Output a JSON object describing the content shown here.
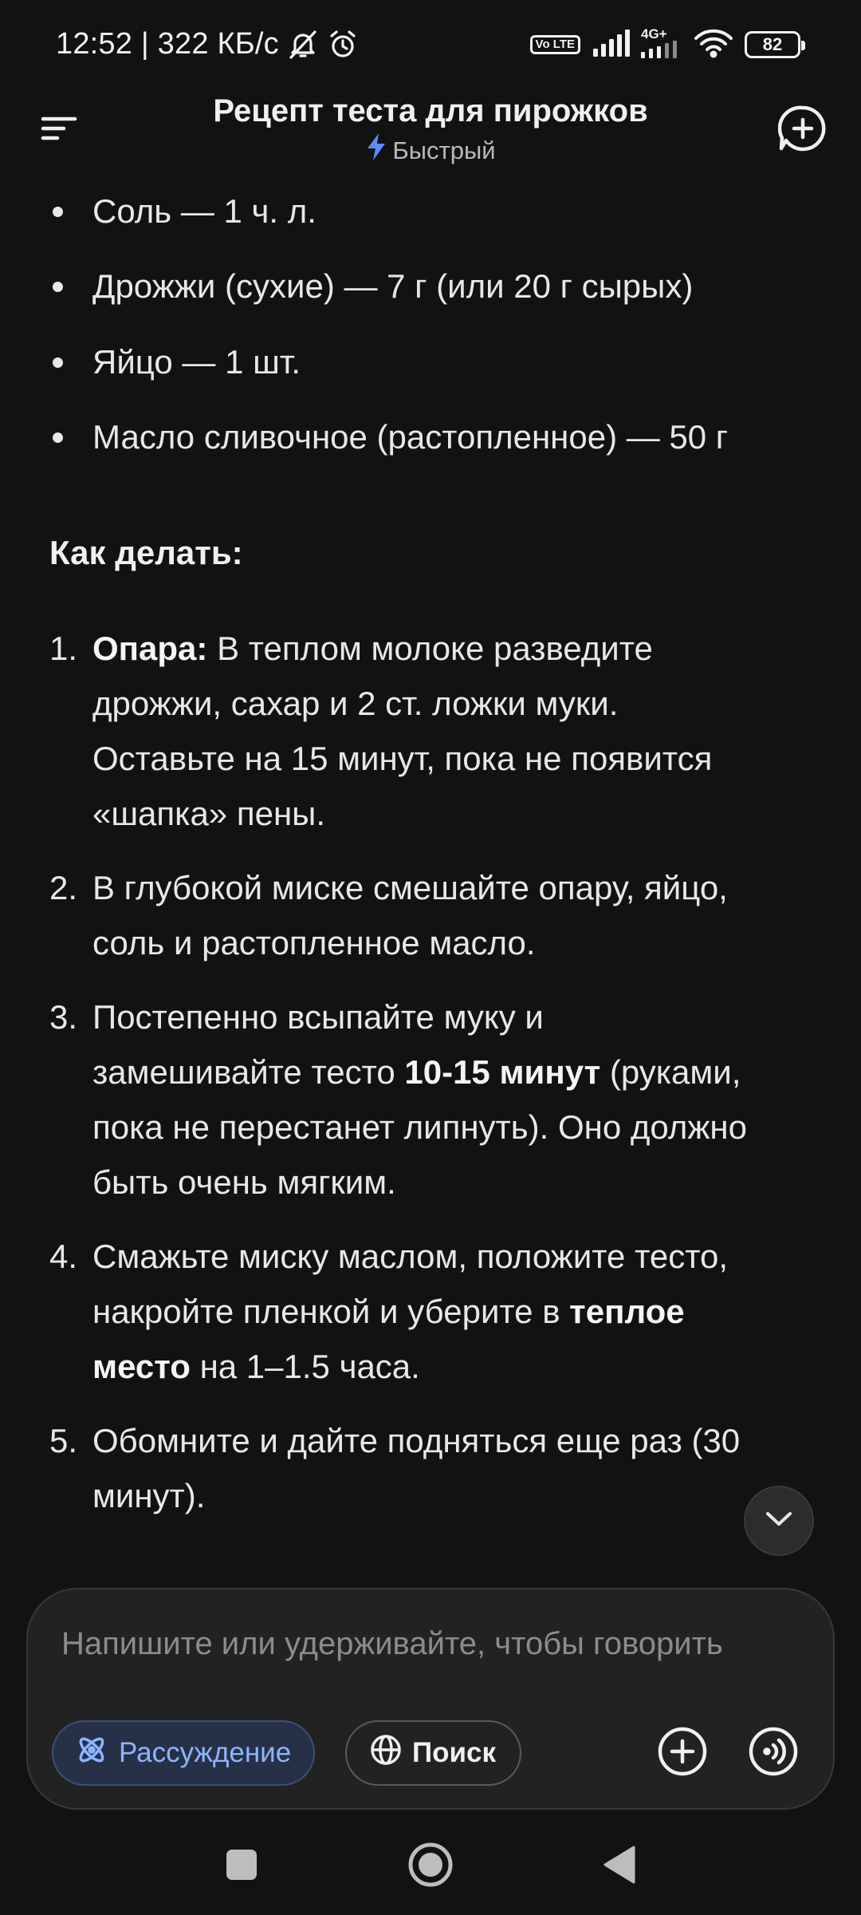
{
  "status_bar": {
    "time_speed": "12:52 | 322 КБ/с",
    "volte": "Vo LTE",
    "network_type": "4G+",
    "battery": "82"
  },
  "header": {
    "title": "Рецепт теста для пирожков",
    "mode": "Быстрый",
    "accent_color": "#5b8cff"
  },
  "ingredients": [
    "Соль — 1 ч. л.",
    "Дрожжи (сухие) — 7 г (или 20 г сырых)",
    "Яйцо — 1 шт.",
    "Масло сливочное (растопленное) — 50 г"
  ],
  "how_to_heading": "Как делать:",
  "steps": [
    {
      "num": "1.",
      "lines": [
        [
          {
            "t": "Опара:",
            "b": true
          },
          {
            "t": " В теплом молоке разведите",
            "b": false
          }
        ],
        [
          {
            "t": "дрожжи, сахар и 2 ст. ложки муки.",
            "b": false
          }
        ],
        [
          {
            "t": "Оставьте на 15 минут, пока не появится",
            "b": false
          }
        ],
        [
          {
            "t": "«шапка» пены.",
            "b": false
          }
        ]
      ]
    },
    {
      "num": "2.",
      "lines": [
        [
          {
            "t": "В глубокой миске смешайте опару, яйцо,",
            "b": false
          }
        ],
        [
          {
            "t": "соль и растопленное масло.",
            "b": false
          }
        ]
      ]
    },
    {
      "num": "3.",
      "lines": [
        [
          {
            "t": "Постепенно всыпайте муку и",
            "b": false
          }
        ],
        [
          {
            "t": "замешивайте тесто ",
            "b": false
          },
          {
            "t": "10-15 минут",
            "b": true
          },
          {
            "t": " (руками,",
            "b": false
          }
        ],
        [
          {
            "t": "пока не перестанет липнуть). Оно должно",
            "b": false
          }
        ],
        [
          {
            "t": "быть очень мягким.",
            "b": false
          }
        ]
      ]
    },
    {
      "num": "4.",
      "lines": [
        [
          {
            "t": "Смажьте миску маслом, положите тесто,",
            "b": false
          }
        ],
        [
          {
            "t": "накройте пленкой и уберите в ",
            "b": false
          },
          {
            "t": "теплое",
            "b": true
          }
        ],
        [
          {
            "t": "место",
            "b": true
          },
          {
            "t": " на 1–1.5 часа.",
            "b": false
          }
        ]
      ]
    },
    {
      "num": "5.",
      "lines": [
        [
          {
            "t": "Обомните и дайте подняться еще раз (30",
            "b": false
          }
        ],
        [
          {
            "t": "минут).",
            "b": false
          }
        ]
      ]
    }
  ],
  "composer": {
    "placeholder": "Напишите или удерживайте, чтобы говорить",
    "reasoning_label": "Рассуждение",
    "search_label": "Поиск",
    "reasoning_color": "#8fb4ff"
  },
  "icons": {
    "menu": "menu-icon",
    "new_chat": "new-chat-icon",
    "scroll_down": "chevron-down-icon",
    "attach": "plus-circle-icon",
    "voice": "voice-wave-icon",
    "reasoning": "atom-icon",
    "search": "globe-icon"
  }
}
